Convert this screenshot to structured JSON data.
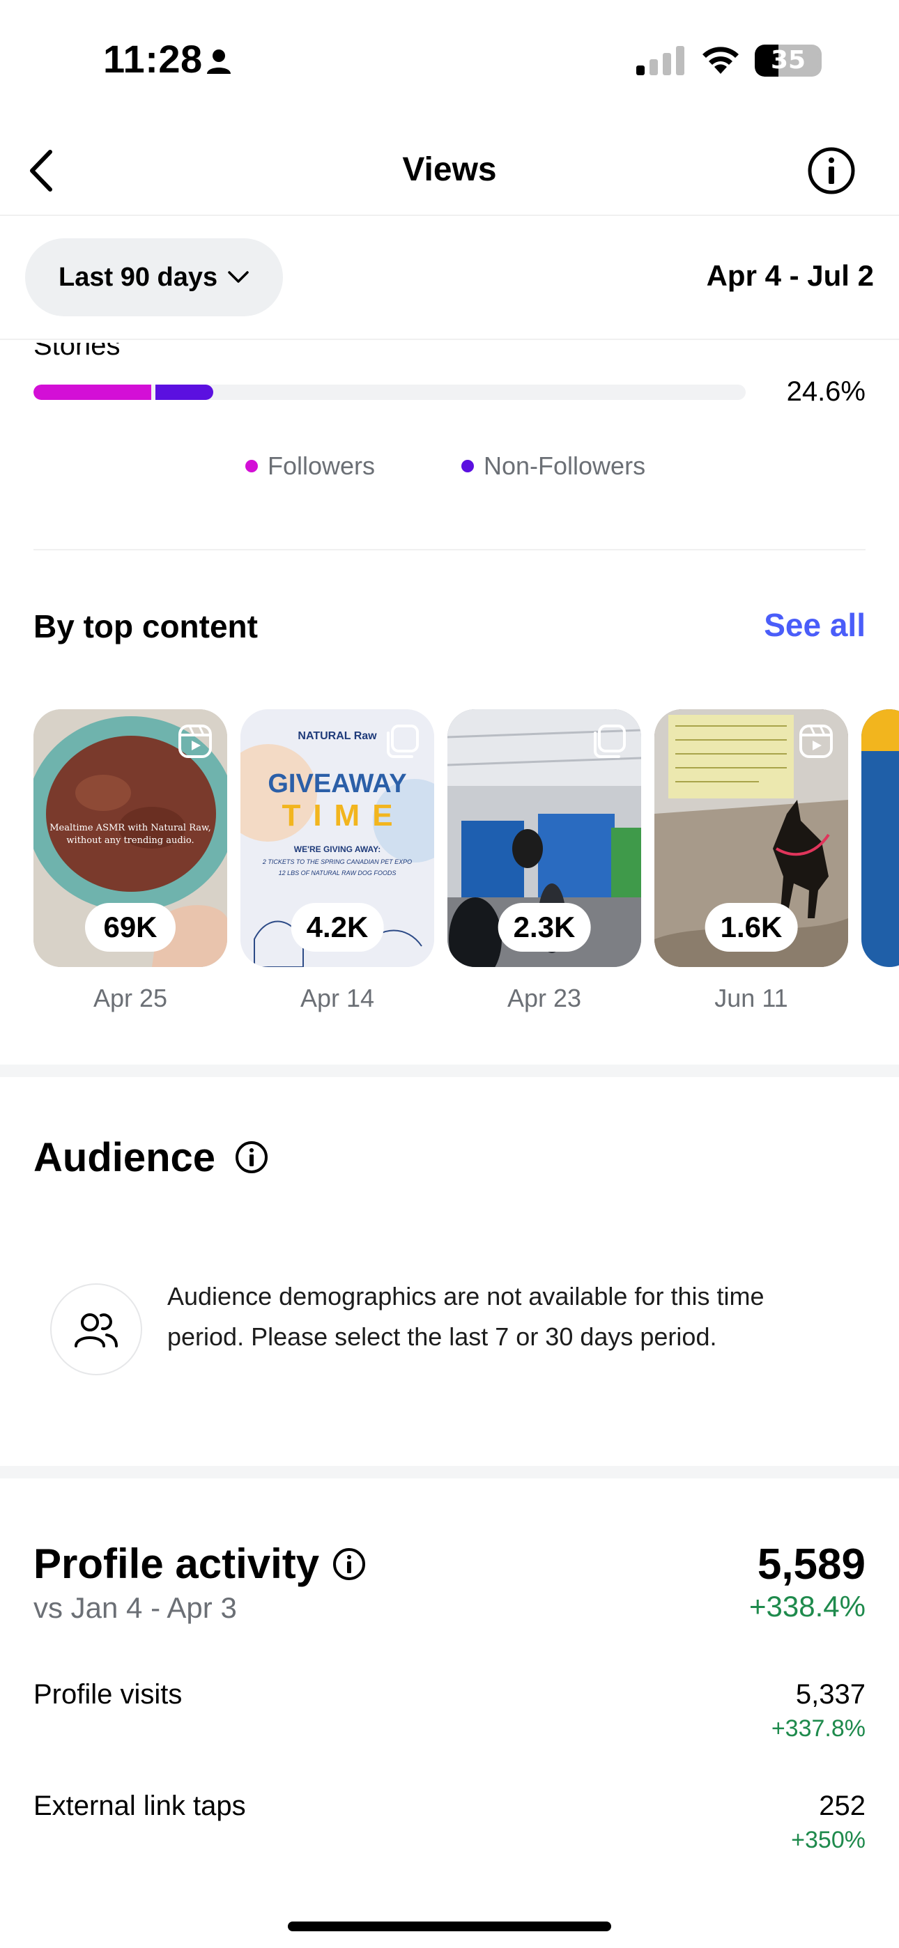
{
  "status_bar": {
    "time": "11:28",
    "battery": "35",
    "battery_level": 0.35
  },
  "nav": {
    "title": "Views"
  },
  "filter": {
    "range_label": "Last 90 days",
    "dates": "Apr 4 - Jul 2"
  },
  "stories": {
    "label": "Stories",
    "percent": "24.6%",
    "followers_fraction": 0.165,
    "non_followers_fraction": 0.081,
    "followers_color": "#d30fd6",
    "non_followers_color": "#5b10e0"
  },
  "legend": {
    "followers": "Followers",
    "non_followers": "Non-Followers"
  },
  "top_content": {
    "title": "By top content",
    "see_all": "See all",
    "items": [
      {
        "views": "69K",
        "date": "Apr 25",
        "icon": "reel-icon",
        "caption": "Mealtime ASMR with Natural Raw, without any trending audio."
      },
      {
        "views": "4.2K",
        "date": "Apr 14",
        "icon": "post-icon",
        "brand": "NATURAL Raw",
        "headline_1": "GIVEAWAY",
        "headline_2": "TIME",
        "sub": "WE'RE GIVING AWAY:",
        "line_1": "2 TICKETS TO THE SPRING CANADIAN PET EXPO",
        "line_2": "12 LBS OF NATURAL RAW DOG FOODS"
      },
      {
        "views": "2.3K",
        "date": "Apr 23",
        "icon": "post-icon"
      },
      {
        "views": "1.6K",
        "date": "Jun 11",
        "icon": "reel-icon"
      }
    ]
  },
  "audience": {
    "title": "Audience",
    "message": "Audience demographics are not available for this time period. Please select the last 7 or 30 days period."
  },
  "profile_activity": {
    "title": "Profile activity",
    "total": "5,589",
    "compare": "vs Jan 4 - Apr 3",
    "change": "+338.4%",
    "rows": [
      {
        "label": "Profile visits",
        "value": "5,337",
        "change": "+337.8%"
      },
      {
        "label": "External link taps",
        "value": "252",
        "change": "+350%"
      }
    ]
  },
  "colors": {
    "accent_link": "#4a5df9",
    "positive": "#1e8a4c"
  }
}
